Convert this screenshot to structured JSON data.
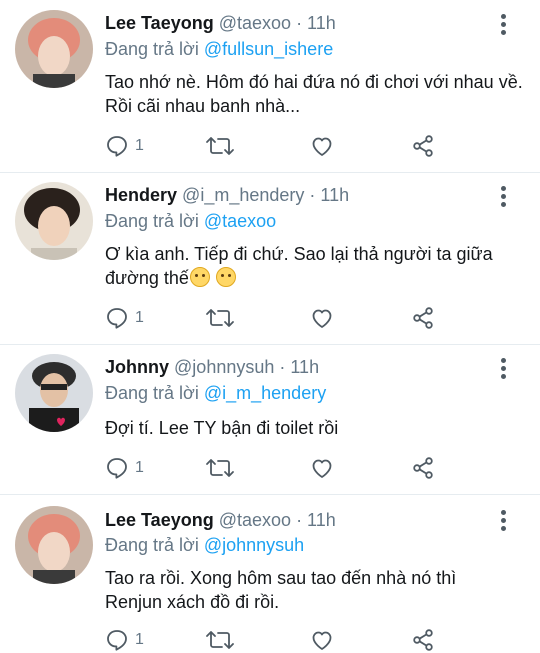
{
  "tweets": [
    {
      "name": "Lee Taeyong",
      "handle": "@taexoo",
      "time": "· 11h",
      "reply_prefix": "Đang trả lời",
      "reply_to": "@fullsun_ishere",
      "text": "Tao nhớ nè. Hôm đó hai đứa nó đi chơi với nhau về. Rồi cãi nhau banh nhà...",
      "reply_count": "1"
    },
    {
      "name": "Hendery",
      "handle": "@i_m_hendery",
      "time": "· 11h",
      "reply_prefix": "Đang trả lời",
      "reply_to": "@taexoo",
      "text": "Ơ kìa anh. Tiếp đi chứ. Sao lại thả người ta giữa đường thế",
      "reply_count": "1"
    },
    {
      "name": "Johnny",
      "handle": "@johnnysuh",
      "time": "· 11h",
      "reply_prefix": "Đang trả lời",
      "reply_to": "@i_m_hendery",
      "text": "Đợi tí. Lee TY bận đi toilet rồi",
      "reply_count": "1"
    },
    {
      "name": "Lee Taeyong",
      "handle": "@taexoo",
      "time": "· 11h",
      "reply_prefix": "Đang trả lời",
      "reply_to": "@johnnysuh",
      "text": "Tao ra rồi. Xong hôm sau tao đến nhà nó thì Renjun xách đồ đi rồi.",
      "reply_count": "1"
    }
  ],
  "icons": [
    "reply-icon",
    "retweet-icon",
    "like-icon",
    "share-icon",
    "more-icon"
  ],
  "colors": {
    "link": "#1da1f2",
    "muted": "#657786",
    "icon": "#4f5a63"
  }
}
